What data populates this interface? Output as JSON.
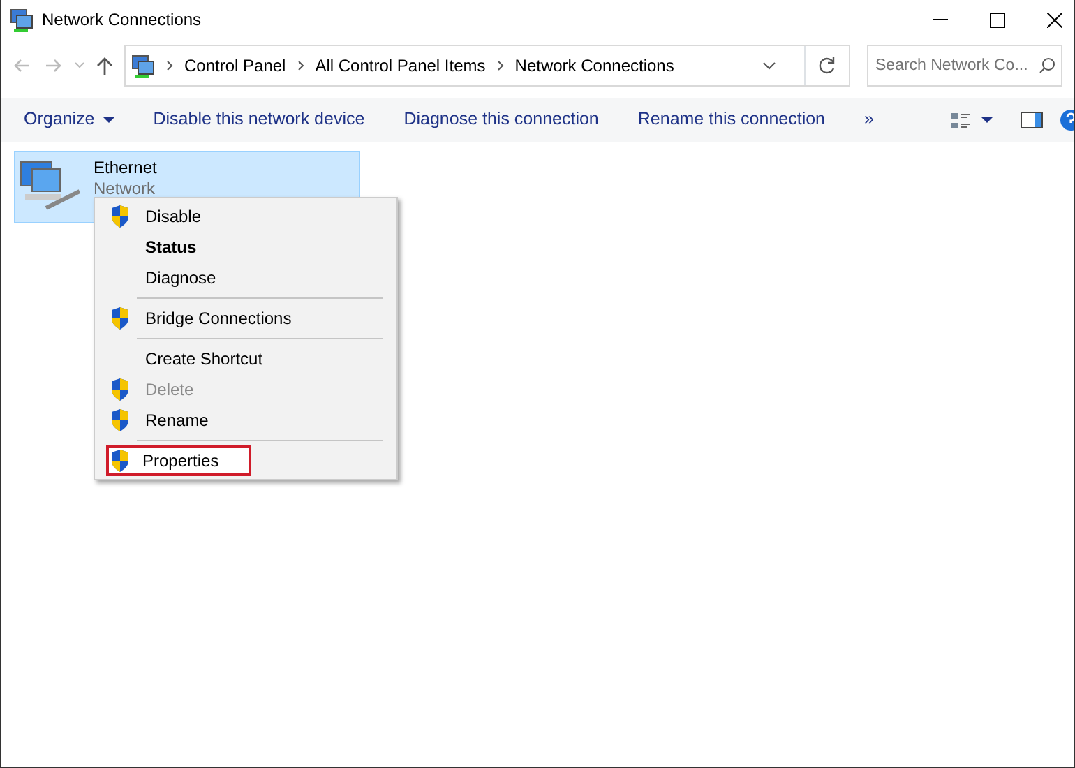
{
  "window": {
    "title": "Network Connections"
  },
  "address_bar": {
    "crumbs": [
      "Control Panel",
      "All Control Panel Items",
      "Network Connections"
    ]
  },
  "search": {
    "placeholder": "Search Network Co..."
  },
  "toolbar": {
    "items": [
      {
        "label": "Organize",
        "dropdown": true
      },
      {
        "label": "Disable this network device",
        "dropdown": false
      },
      {
        "label": "Diagnose this connection",
        "dropdown": false
      },
      {
        "label": "Rename this connection",
        "dropdown": false
      },
      {
        "label": "»",
        "dropdown": false
      }
    ]
  },
  "connections": [
    {
      "name": "Ethernet",
      "status": "Network",
      "selected": true
    }
  ],
  "context_menu": {
    "items": [
      {
        "kind": "item",
        "label": "Disable",
        "shield": true,
        "bold": false,
        "disabled": false,
        "selected": false
      },
      {
        "kind": "item",
        "label": "Status",
        "shield": false,
        "bold": true,
        "disabled": false,
        "selected": false
      },
      {
        "kind": "item",
        "label": "Diagnose",
        "shield": false,
        "bold": false,
        "disabled": false,
        "selected": false
      },
      {
        "kind": "separator"
      },
      {
        "kind": "item",
        "label": "Bridge Connections",
        "shield": true,
        "bold": false,
        "disabled": false,
        "selected": false
      },
      {
        "kind": "separator"
      },
      {
        "kind": "item",
        "label": "Create Shortcut",
        "shield": false,
        "bold": false,
        "disabled": false,
        "selected": false
      },
      {
        "kind": "item",
        "label": "Delete",
        "shield": true,
        "bold": false,
        "disabled": true,
        "selected": false
      },
      {
        "kind": "item",
        "label": "Rename",
        "shield": true,
        "bold": false,
        "disabled": false,
        "selected": false
      },
      {
        "kind": "separator"
      },
      {
        "kind": "item",
        "label": "Properties",
        "shield": true,
        "bold": false,
        "disabled": false,
        "selected": true
      }
    ]
  }
}
